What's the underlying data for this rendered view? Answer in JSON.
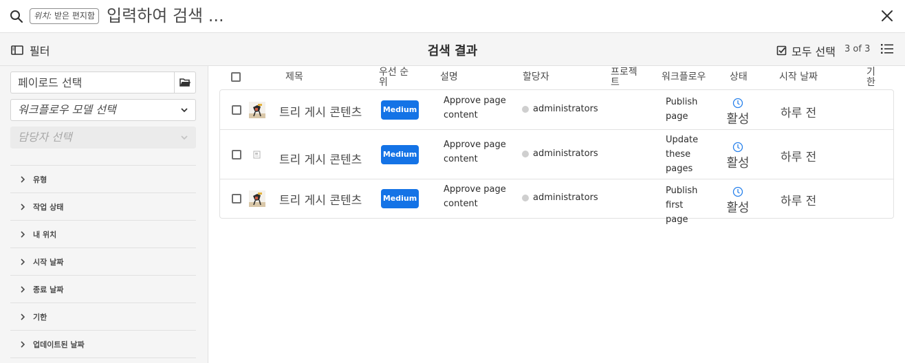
{
  "search": {
    "location_prefix": "위치:",
    "location_value": "받은 편지함",
    "placeholder": "입력하여 검색 ..."
  },
  "toolbar": {
    "filter_label": "필터",
    "title": "검색 결과",
    "select_all_label": "모두 선택",
    "count": "3 of 3"
  },
  "filters": {
    "payload_placeholder": "페이로드 선택",
    "workflow_model_placeholder": "워크플로우 모델 선택",
    "assignee_placeholder": "담당자 선택",
    "facets": [
      "유형",
      "작업 상태",
      "내 위치",
      "시작 날짜",
      "종료 날짜",
      "기한",
      "업데이트된 날짜"
    ]
  },
  "table": {
    "columns": {
      "title": "제목",
      "priority": "우선 순위",
      "description": "설명",
      "assignee": "할당자",
      "project": "프로젝트",
      "workflow": "워크플로우",
      "status": "상태",
      "start_date": "시작 날짜",
      "due": "기한"
    },
    "rows": [
      {
        "title": "트리 게시 콘텐츠",
        "priority": "Medium",
        "description": "Approve page content",
        "assignee": "administrators",
        "workflow": "Publish page",
        "status": "활성",
        "start_date": "하루 전",
        "thumbnail": "image"
      },
      {
        "title": "트리 게시 콘텐츠",
        "priority": "Medium",
        "description": "Approve page content",
        "assignee": "administrators",
        "workflow": "Update these pages",
        "status": "활성",
        "start_date": "하루 전",
        "thumbnail": "pages"
      },
      {
        "title": "트리 게시 콘텐츠",
        "priority": "Medium",
        "description": "Approve page content",
        "assignee": "administrators",
        "workflow": "Publish first page",
        "status": "활성",
        "start_date": "하루 전",
        "thumbnail": "image"
      }
    ]
  },
  "colors": {
    "accent": "#1473e6",
    "panel_bg": "#f5f5f5",
    "status_icon": "#2680eb"
  }
}
